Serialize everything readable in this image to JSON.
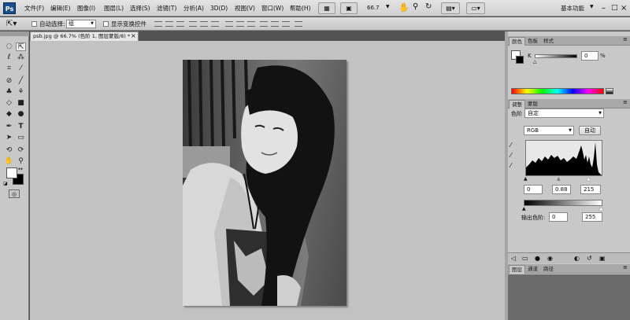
{
  "app": {
    "logo": "Ps",
    "workspace": "基本功能"
  },
  "menu": [
    "文件(F)",
    "编辑(E)",
    "图像(I)",
    "图层(L)",
    "选择(S)",
    "滤镜(T)",
    "分析(A)",
    "3D(D)",
    "视图(V)",
    "窗口(W)",
    "帮助(H)"
  ],
  "toolbar": {
    "zoom": "66.7"
  },
  "options": {
    "auto_select_label": "自动选择:",
    "auto_select_value": "组",
    "show_transform_label": "显示变换控件"
  },
  "document": {
    "tab_title": "psb.jpg @ 66.7% (色阶 1, 图层蒙版/8) *",
    "close": "×"
  },
  "color_panel": {
    "tabs": [
      "颜色",
      "色板",
      "样式"
    ],
    "channel_label": "K",
    "value": "0",
    "unit": "%"
  },
  "adjust_panel": {
    "tabs": [
      "调整",
      "蒙版"
    ],
    "preset_label": "色阶",
    "preset_value": "自定",
    "channel": "RGB",
    "auto_button": "自动",
    "input_black": "0",
    "input_gamma": "0.88",
    "input_white": "215",
    "output_label": "输出色阶:",
    "output_black": "0",
    "output_white": "255"
  },
  "layers_panel": {
    "tabs": [
      "图层",
      "通道",
      "路径"
    ]
  }
}
